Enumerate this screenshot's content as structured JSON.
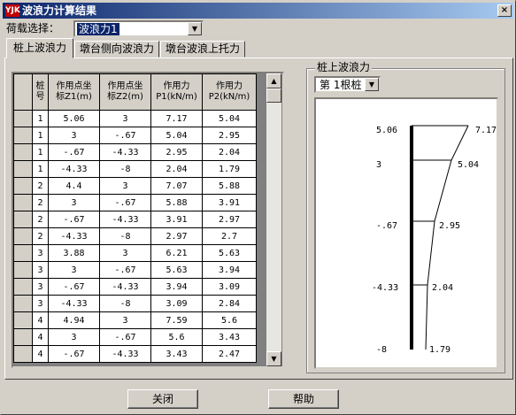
{
  "window": {
    "title": "波浪力计算结果",
    "icon_text": "YJK",
    "close_label": "×"
  },
  "load_selector": {
    "label": "荷载选择：",
    "value": "波浪力1"
  },
  "tabs": [
    {
      "label": "桩上波浪力",
      "active": true
    },
    {
      "label": "墩台侧向波浪力",
      "active": false
    },
    {
      "label": "墩台波浪上托力",
      "active": false
    }
  ],
  "table": {
    "headers": [
      "桩\n号",
      "作用点坐\n标Z1(m)",
      "作用点坐\n标Z2(m)",
      "作用力\nP1(kN/m)",
      "作用力\nP2(kN/m)"
    ],
    "rows": [
      [
        "1",
        "5.06",
        "3",
        "7.17",
        "5.04"
      ],
      [
        "1",
        "3",
        "-.67",
        "5.04",
        "2.95"
      ],
      [
        "1",
        "-.67",
        "-4.33",
        "2.95",
        "2.04"
      ],
      [
        "1",
        "-4.33",
        "-8",
        "2.04",
        "1.79"
      ],
      [
        "2",
        "4.4",
        "3",
        "7.07",
        "5.88"
      ],
      [
        "2",
        "3",
        "-.67",
        "5.88",
        "3.91"
      ],
      [
        "2",
        "-.67",
        "-4.33",
        "3.91",
        "2.97"
      ],
      [
        "2",
        "-4.33",
        "-8",
        "2.97",
        "2.7"
      ],
      [
        "3",
        "3.88",
        "3",
        "6.21",
        "5.63"
      ],
      [
        "3",
        "3",
        "-.67",
        "5.63",
        "3.94"
      ],
      [
        "3",
        "-.67",
        "-4.33",
        "3.94",
        "3.09"
      ],
      [
        "3",
        "-4.33",
        "-8",
        "3.09",
        "2.84"
      ],
      [
        "4",
        "4.94",
        "3",
        "7.59",
        "5.6"
      ],
      [
        "4",
        "3",
        "-.67",
        "5.6",
        "3.43"
      ],
      [
        "4",
        "-.67",
        "-4.33",
        "3.43",
        "2.47"
      ]
    ]
  },
  "scrollbar": {
    "up_icon": "▲",
    "down_icon": "▼"
  },
  "pile_panel": {
    "group_label": "桩上波浪力",
    "pile_selector": "第 1根桩",
    "elevations": [
      "5.06",
      "3",
      "-.67",
      "-4.33",
      "-8"
    ],
    "forces": [
      "7.17",
      "5.04",
      "2.95",
      "2.04",
      "1.79"
    ]
  },
  "buttons": {
    "close": "关闭",
    "help": "帮助"
  },
  "colors": {
    "title_start": "#0a246a",
    "title_end": "#a6caf0",
    "selection": "#0a246a",
    "face": "#d4d0c8"
  }
}
